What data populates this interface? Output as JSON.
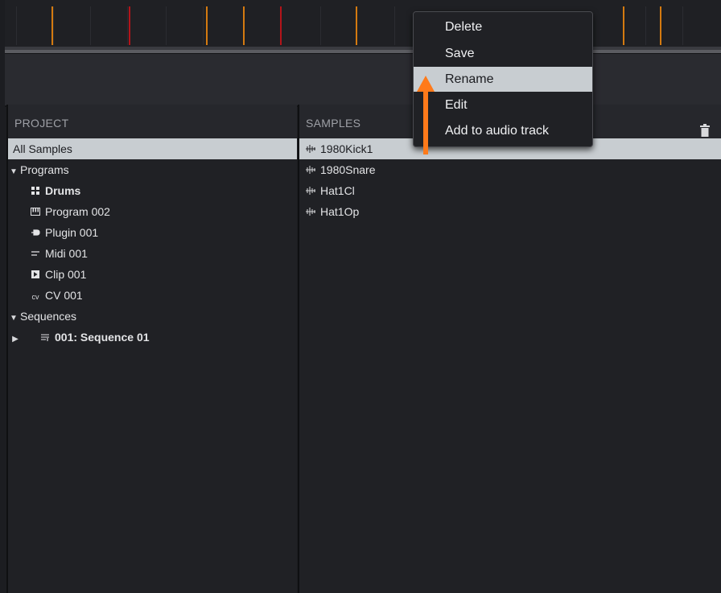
{
  "project_panel": {
    "header": "PROJECT",
    "items": {
      "all_samples": "All Samples",
      "programs": "Programs",
      "drums": "Drums",
      "program_002": "Program 002",
      "plugin_001": "Plugin 001",
      "midi_001": "Midi 001",
      "clip_001": "Clip 001",
      "cv_001": "CV 001",
      "sequences": "Sequences",
      "sequence_01": "001: Sequence 01"
    },
    "icons": {
      "disclosure_open": "▼",
      "disclosure_closed": "▶",
      "drums": "drum-grid-icon",
      "program": "keyboard-icon",
      "plugin": "plug-icon",
      "midi": "midi-icon",
      "clip": "clip-icon",
      "cv_glyph": "cv",
      "sequence": "sequence-icon"
    }
  },
  "samples_panel": {
    "header": "SAMPLES",
    "samples": [
      "1980Kick1",
      "1980Snare",
      "Hat1Cl",
      "Hat1Op"
    ],
    "selected_index": 0,
    "trash_icon": "trash-icon"
  },
  "context_menu": {
    "items": [
      "Delete",
      "Save",
      "Rename",
      "Edit",
      "Add to audio track"
    ],
    "highlighted": "Rename"
  },
  "annotation": {
    "arrow_color": "#ff7a1a",
    "points_to": "Rename"
  },
  "colors": {
    "timeline_orange": "#d47a10",
    "timeline_red": "#b3141a",
    "selection": "#c8cdd1"
  }
}
